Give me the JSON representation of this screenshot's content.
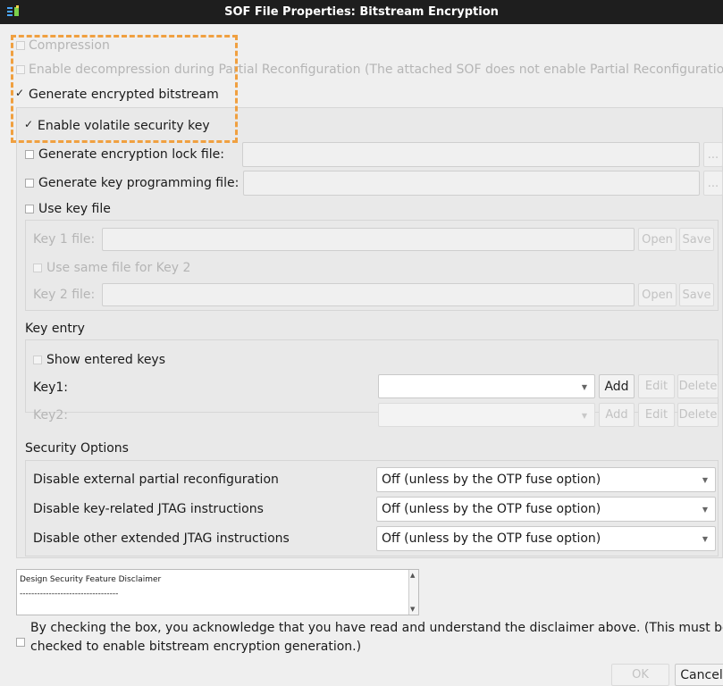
{
  "window": {
    "title": "SOF File Properties: Bitstream Encryption",
    "icon": "app-icon"
  },
  "options": {
    "compression": "Compression",
    "enable_decompression": "Enable decompression during Partial Reconfiguration (The attached SOF does not enable Partial Reconfiguration)",
    "generate_encrypted": "Generate encrypted bitstream",
    "volatile_key": "Enable volatile security key",
    "lock_file": "Generate encryption lock file:",
    "key_prog_file": "Generate key programming file:",
    "use_key_file": "Use key file"
  },
  "browse_label": "...",
  "key_file_section": {
    "key1_label": "Key 1 file:",
    "key2_label": "Key 2 file:",
    "same_file": "Use same file for Key 2",
    "open": "Open",
    "save": "Save"
  },
  "key_entry": {
    "heading": "Key entry",
    "show_keys": "Show entered keys",
    "key1_label": "Key1:",
    "key2_label": "Key2:",
    "add": "Add",
    "edit": "Edit",
    "delete": "Delete"
  },
  "security": {
    "heading": "Security Options",
    "rows": [
      {
        "label": "Disable external partial reconfiguration",
        "value": "Off (unless by the OTP fuse option)"
      },
      {
        "label": "Disable key-related JTAG instructions",
        "value": "Off (unless by the OTP fuse option)"
      },
      {
        "label": "Disable other extended JTAG instructions",
        "value": "Off (unless by the OTP fuse option)"
      }
    ]
  },
  "disclaimer": {
    "title": "Design Security Feature Disclaimer",
    "divider": "----------------------------------",
    "ack_line1": "By checking the box, you acknowledge that you have read and understand the disclaimer above. (This must be",
    "ack_line2": "checked to enable bitstream encryption generation.)"
  },
  "footer": {
    "ok": "OK",
    "cancel": "Cancel"
  },
  "colors": {
    "highlight": "#f0a040",
    "titlebar": "#1e1e1e"
  }
}
